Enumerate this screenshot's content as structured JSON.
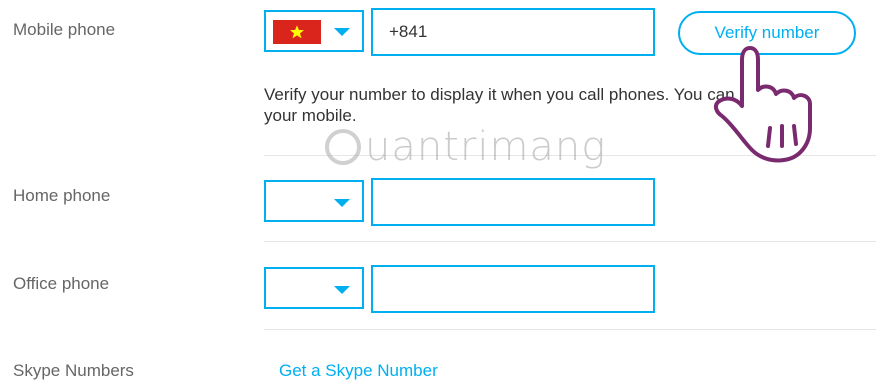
{
  "mobile": {
    "label": "Mobile phone",
    "country_flag": "vietnam-flag",
    "phone_value": "+841",
    "verify_label": "Verify number",
    "help_line1": "Verify your number to display it when you call phones. You can also r",
    "help_line2": "your mobile."
  },
  "home": {
    "label": "Home phone",
    "phone_value": ""
  },
  "office": {
    "label": "Office phone",
    "phone_value": ""
  },
  "skype_numbers": {
    "label": "Skype Numbers",
    "link_label": "Get a Skype Number"
  },
  "watermark": {
    "text": "uantrimang"
  },
  "colors": {
    "accent": "#00aff0",
    "flag_red": "#da251d",
    "flag_star": "#ffff00",
    "label_gray": "#666666",
    "hand_outline": "#7a2a6e"
  }
}
